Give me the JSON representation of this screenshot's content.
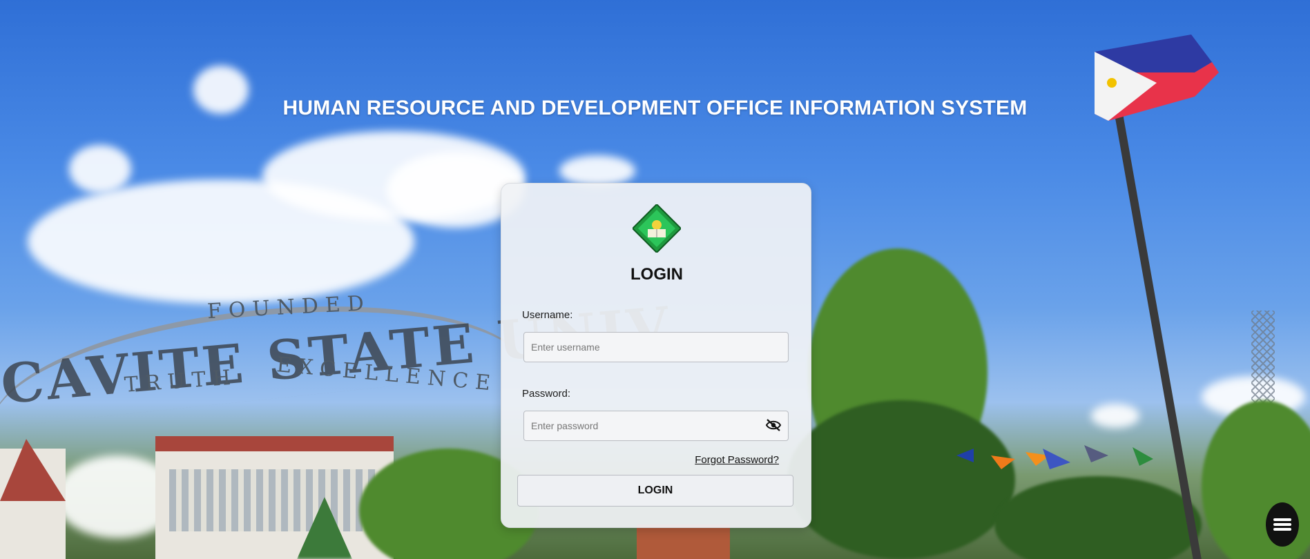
{
  "header": {
    "title": "HUMAN RESOURCE AND DEVELOPMENT OFFICE INFORMATION SYSTEM"
  },
  "background": {
    "arch_text": "CAVITE STATE UNIV",
    "arch_top_text": "FOUNDED",
    "arch_bottom_left": "TRUTH",
    "arch_bottom_right": "EXCELLENCE"
  },
  "login_card": {
    "heading": "LOGIN",
    "username_label": "Username:",
    "username_placeholder": "Enter username",
    "username_value": "",
    "password_label": "Password:",
    "password_placeholder": "Enter password",
    "password_value": "",
    "forgot_label": "Forgot Password?",
    "login_button": "LOGIN"
  },
  "icons": {
    "logo": "university-seal-logo",
    "eye": "eye-slash-icon",
    "menu": "hamburger-menu-icon"
  },
  "colors": {
    "logo_green": "#1e9a3e",
    "sky": "#3b7be0"
  }
}
